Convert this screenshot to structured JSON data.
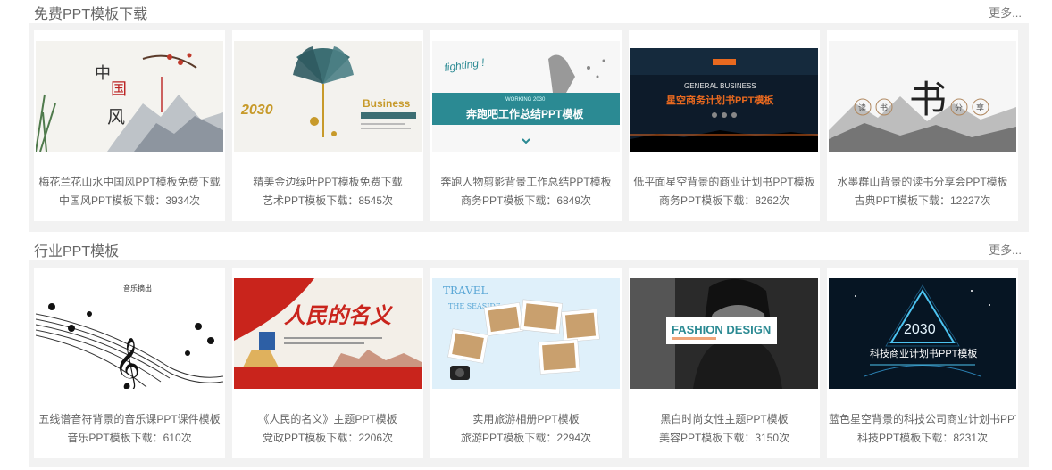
{
  "sections": [
    {
      "title": "免费PPT模板下载",
      "more": "更多...",
      "items": [
        {
          "title": "梅花兰花山水中国风PPT模板免费下载",
          "category": "中国风PPT模板",
          "downloads": "下载：3934次",
          "thumb_text": [
            "中",
            "国",
            "风"
          ]
        },
        {
          "title": "精美金边绿叶PPT模板免费下载",
          "category": "艺术PPT模板",
          "downloads": "下载：8545次",
          "thumb_text": [
            "2030",
            "Business"
          ]
        },
        {
          "title": "奔跑人物剪影背景工作总结PPT模板",
          "category": "商务PPT模板",
          "downloads": "下载：6849次",
          "thumb_text": [
            "fighting !",
            "WORKING 2030",
            "奔跑吧工作总结PPT模板"
          ]
        },
        {
          "title": "低平面星空背景的商业计划书PPT模板",
          "category": "商务PPT模板",
          "downloads": "下载：8262次",
          "thumb_text": [
            "GENERAL BUSINESS",
            "星空商务计划书PPT模板"
          ]
        },
        {
          "title": "水墨群山背景的读书分享会PPT模板",
          "category": "古典PPT模板",
          "downloads": "下载：12227次",
          "thumb_text": [
            "书",
            "读",
            "书",
            "分",
            "享"
          ]
        }
      ]
    },
    {
      "title": "行业PPT模板",
      "more": "更多...",
      "items": [
        {
          "title": "五线谱音符背景的音乐课PPT课件模板",
          "category": "音乐PPT模板",
          "downloads": "下载：610次",
          "thumb_text": [
            "音乐摘出"
          ]
        },
        {
          "title": "《人民的名义》主题PPT模板",
          "category": "党政PPT模板",
          "downloads": "下载：2206次",
          "thumb_text": [
            "人民的名义"
          ]
        },
        {
          "title": "实用旅游相册PPT模板",
          "category": "旅游PPT模板",
          "downloads": "下载：2294次",
          "thumb_text": [
            "TRAVEL",
            "THE SEASIDE"
          ]
        },
        {
          "title": "黑白时尚女性主题PPT模板",
          "category": "美容PPT模板",
          "downloads": "下载：3150次",
          "thumb_text": [
            "FASHION DESIGN"
          ]
        },
        {
          "title": "蓝色星空背景的科技公司商业计划书PPT",
          "category": "科技PPT模板",
          "downloads": "下载：8231次",
          "thumb_text": [
            "2030",
            "科技商业计划书PPT模板"
          ]
        }
      ]
    }
  ],
  "colors": {
    "panel": "#f2f2f2",
    "text": "#666666",
    "teal": "#2b8a93",
    "orange": "#e8691f",
    "red": "#c9241c"
  }
}
